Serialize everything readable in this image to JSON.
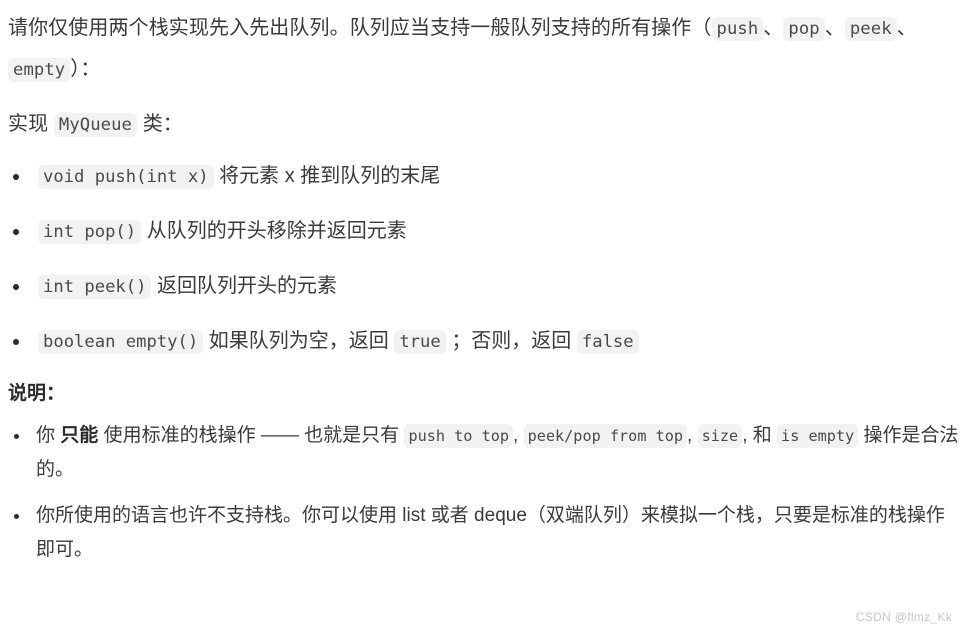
{
  "document": {
    "intro": {
      "text_part1": "请你仅使用两个栈实现先入先出队列。队列应当支持一般队列支持的所有操作（",
      "code1": "push",
      "sep1": "、",
      "code2": "pop",
      "sep2": "、",
      "code3": "peek",
      "sep3": "、",
      "code4": "empty",
      "text_part2": "）："
    },
    "implement_line": {
      "prefix": "实现",
      "class_name": "MyQueue",
      "suffix": "类："
    },
    "methods": [
      {
        "signature": "void push(int x)",
        "description": "将元素 x 推到队列的末尾"
      },
      {
        "signature": "int pop()",
        "description": "从队列的开头移除并返回元素"
      },
      {
        "signature": "int peek()",
        "description": "返回队列开头的元素"
      },
      {
        "signature": "boolean empty()",
        "description_part1": "如果队列为空，返回",
        "code_true": "true",
        "description_part2": "；否则，返回",
        "code_false": "false"
      }
    ],
    "notes_heading": "说明：",
    "notes": [
      {
        "text_a": "你",
        "bold": "只能",
        "text_b": "使用标准的栈操作 —— 也就是只有",
        "code1": "push to top",
        "comma1": ",",
        "code2": "peek/pop from top",
        "comma2": ",",
        "code3": "size",
        "comma3": ",",
        "text_c": "和",
        "code4": "is empty",
        "text_d": "操作是合法的。"
      },
      {
        "text": "你所使用的语言也许不支持栈。你可以使用 list 或者 deque（双端队列）来模拟一个栈，只要是标准的栈操作即可。"
      }
    ],
    "watermark": "CSDN @flmz_Kk"
  }
}
